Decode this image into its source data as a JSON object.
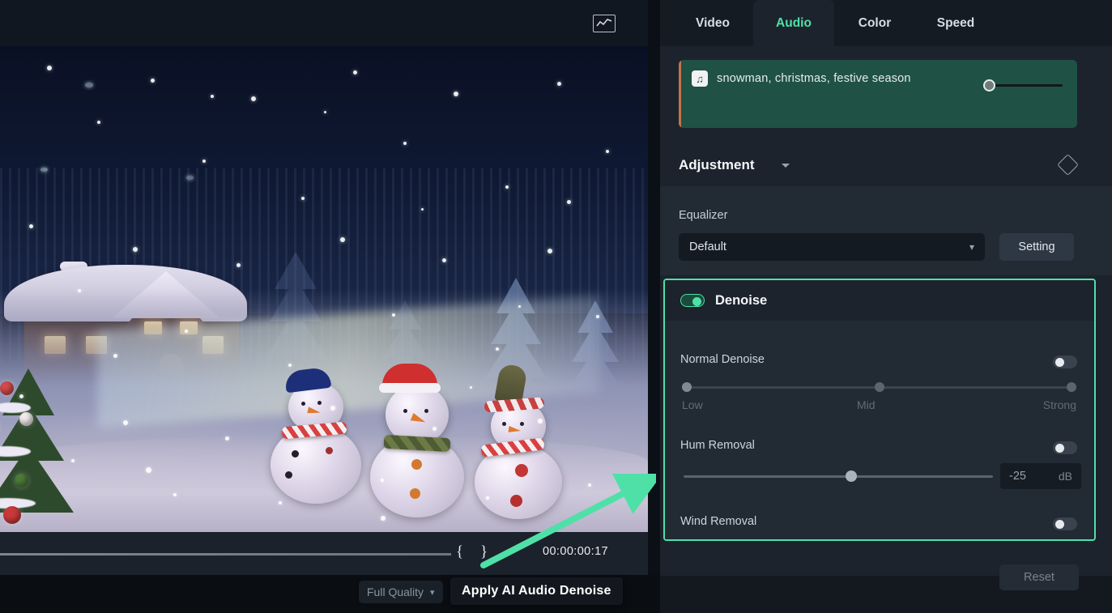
{
  "preview": {
    "curve_icon": "curve-graph-icon",
    "scene_description": "winter christmas scene with snow covered gingerbread house, three snowmen and pine trees"
  },
  "timeline": {
    "mark_in": "{",
    "mark_out": "}",
    "timecode": "00:00:00:17"
  },
  "bottom_bar": {
    "quality_label": "Full Quality",
    "quality_chevron": "chevron-down-icon",
    "tooltip": "Apply AI Audio Denoise"
  },
  "panel": {
    "tabs": [
      {
        "label": "Video",
        "active": false
      },
      {
        "label": "Audio",
        "active": true
      },
      {
        "label": "Color",
        "active": false
      },
      {
        "label": "Speed",
        "active": false
      }
    ],
    "clip": {
      "icon": "music-note-icon",
      "title": "snowman, christmas, festive season",
      "volume_slider": "volume-slider"
    },
    "adjustment": {
      "title": "Adjustment",
      "caret": "caret-down-icon",
      "keyframe_icon": "diamond-keyframe-icon"
    },
    "equalizer": {
      "label": "Equalizer",
      "value": "Default",
      "chevron": "chevron-down-icon",
      "setting_button": "Setting"
    },
    "denoise": {
      "title": "Denoise",
      "enabled": true,
      "rows": [
        {
          "label": "Normal Denoise",
          "enabled": false
        },
        {
          "label": "Hum Removal",
          "enabled": false
        },
        {
          "label": "Wind Removal",
          "enabled": false
        }
      ],
      "normal_denoise_ticks": [
        "Low",
        "Mid",
        "Strong"
      ],
      "hum_value": "-25",
      "hum_unit": "dB"
    },
    "reset_button": "Reset"
  },
  "colors": {
    "accent_green": "#4fe0a8",
    "clip_card_green": "#1f5245",
    "panel_bg": "#1c232c",
    "panel_section_bg": "#222a34"
  }
}
